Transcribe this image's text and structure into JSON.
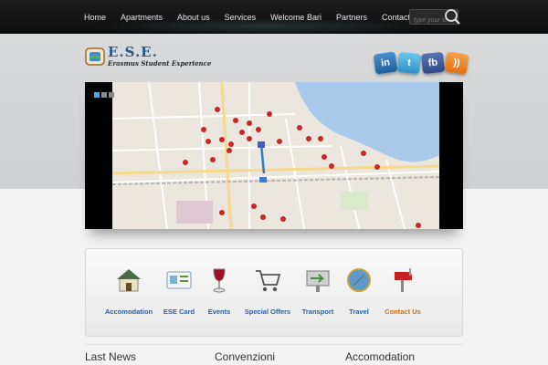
{
  "nav": {
    "items": [
      "Home",
      "Apartments",
      "About us",
      "Services",
      "Welcome Bari",
      "Partners",
      "Contact us"
    ]
  },
  "search": {
    "placeholder": "type your search"
  },
  "logo": {
    "title": "E.S.E.",
    "subtitle": "Erasmus Student Experience"
  },
  "social": {
    "linkedin": "in",
    "twitter": "t",
    "facebook": "fb",
    "rss": "))"
  },
  "features": {
    "accomodation": "Accomodation",
    "ese_card": "ESE Card",
    "events": "Events",
    "special_offers": "Special Offers",
    "transport": "Transport",
    "travel": "Travel",
    "contact": "Contact Us"
  },
  "sections": {
    "news": "Last News",
    "convenzioni": "Convenzioni",
    "accomodation": "Accomodation"
  },
  "colors": {
    "nav_bg": "#141414",
    "link_blue": "#2c5fa0",
    "accent_orange": "#d96c0e",
    "sea": "#a9c9ea"
  }
}
